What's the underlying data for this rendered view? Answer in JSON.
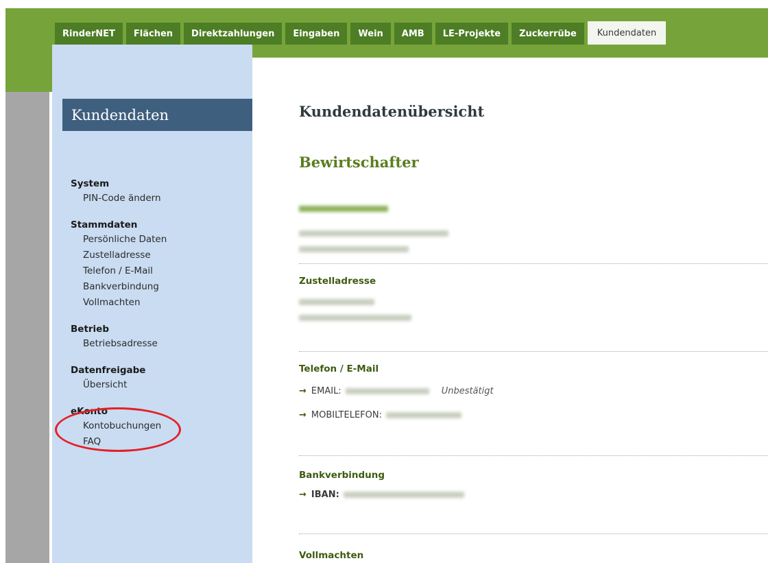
{
  "tabs": [
    {
      "label": "RinderNET"
    },
    {
      "label": "Flächen"
    },
    {
      "label": "Direktzahlungen"
    },
    {
      "label": "Eingaben"
    },
    {
      "label": "Wein"
    },
    {
      "label": "AMB"
    },
    {
      "label": "LE-Projekte"
    },
    {
      "label": "Zuckerrübe"
    },
    {
      "label": "Kundendaten",
      "active": true
    }
  ],
  "sidebar": {
    "title": "Kundendaten",
    "groups": [
      {
        "heading": "System",
        "items": [
          "PIN-Code ändern"
        ]
      },
      {
        "heading": "Stammdaten",
        "items": [
          "Persönliche Daten",
          "Zustelladresse",
          "Telefon / E-Mail",
          "Bankverbindung",
          "Vollmachten"
        ]
      },
      {
        "heading": "Betrieb",
        "items": [
          "Betriebsadresse"
        ]
      },
      {
        "heading": "Datenfreigabe",
        "items": [
          "Übersicht"
        ]
      },
      {
        "heading": "eKonto",
        "items": [
          "Kontobuchungen",
          "FAQ"
        ]
      }
    ]
  },
  "main": {
    "page_title": "Kundendatenübersicht",
    "section_title": "Bewirtschafter",
    "zustelladresse": {
      "heading": "Zustelladresse"
    },
    "telefon": {
      "heading": "Telefon / E-Mail",
      "email_label": "EMAIL:",
      "email_status": "Unbestätigt",
      "mobile_label": "MOBILTELEFON:"
    },
    "bank": {
      "heading": "Bankverbindung",
      "iban_label": "IBAN:"
    },
    "vollmachten": {
      "heading": "Vollmachten"
    }
  },
  "colors": {
    "brand_green": "#76a43a",
    "tab_green": "#4d7d24",
    "sidebar_bg": "#c9dcf1",
    "sidebar_title_bg": "#3f5f7f",
    "highlight": "#e41f26"
  }
}
